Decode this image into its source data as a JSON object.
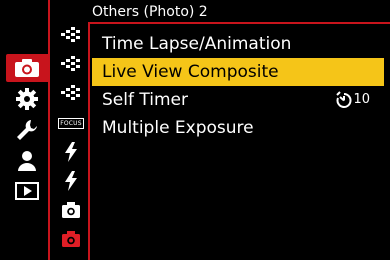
{
  "header": {
    "title": "Others (Photo) 2"
  },
  "menu": {
    "items": [
      {
        "label": "Time Lapse/Animation",
        "selected": false
      },
      {
        "label": "Live View Composite",
        "selected": true
      },
      {
        "label": "Self Timer",
        "selected": false,
        "value": "10",
        "value_icon": "self-timer-icon"
      },
      {
        "label": "Multiple Exposure",
        "selected": false
      }
    ]
  },
  "categories": [
    {
      "name": "photo-camera-icon",
      "active": true
    },
    {
      "name": "gear-icon",
      "active": false
    },
    {
      "name": "wrench-icon",
      "active": false
    },
    {
      "name": "person-icon",
      "active": false
    },
    {
      "name": "playback-icon",
      "active": false
    }
  ],
  "tabs": [
    {
      "name": "image-quality-tab-icon"
    },
    {
      "name": "image-quality-tab-icon-2"
    },
    {
      "name": "image-quality-tab-icon-3"
    },
    {
      "name": "focus-tab-icon",
      "text": "FOCUS"
    },
    {
      "name": "flash-tab-icon"
    },
    {
      "name": "flash-tab-icon-2"
    },
    {
      "name": "others-photo-1-tab-icon"
    },
    {
      "name": "others-photo-2-tab-icon",
      "active": true
    }
  ],
  "colors": {
    "accent": "#c8141c",
    "highlight": "#f5c518",
    "background": "#000000",
    "text": "#ffffff"
  }
}
